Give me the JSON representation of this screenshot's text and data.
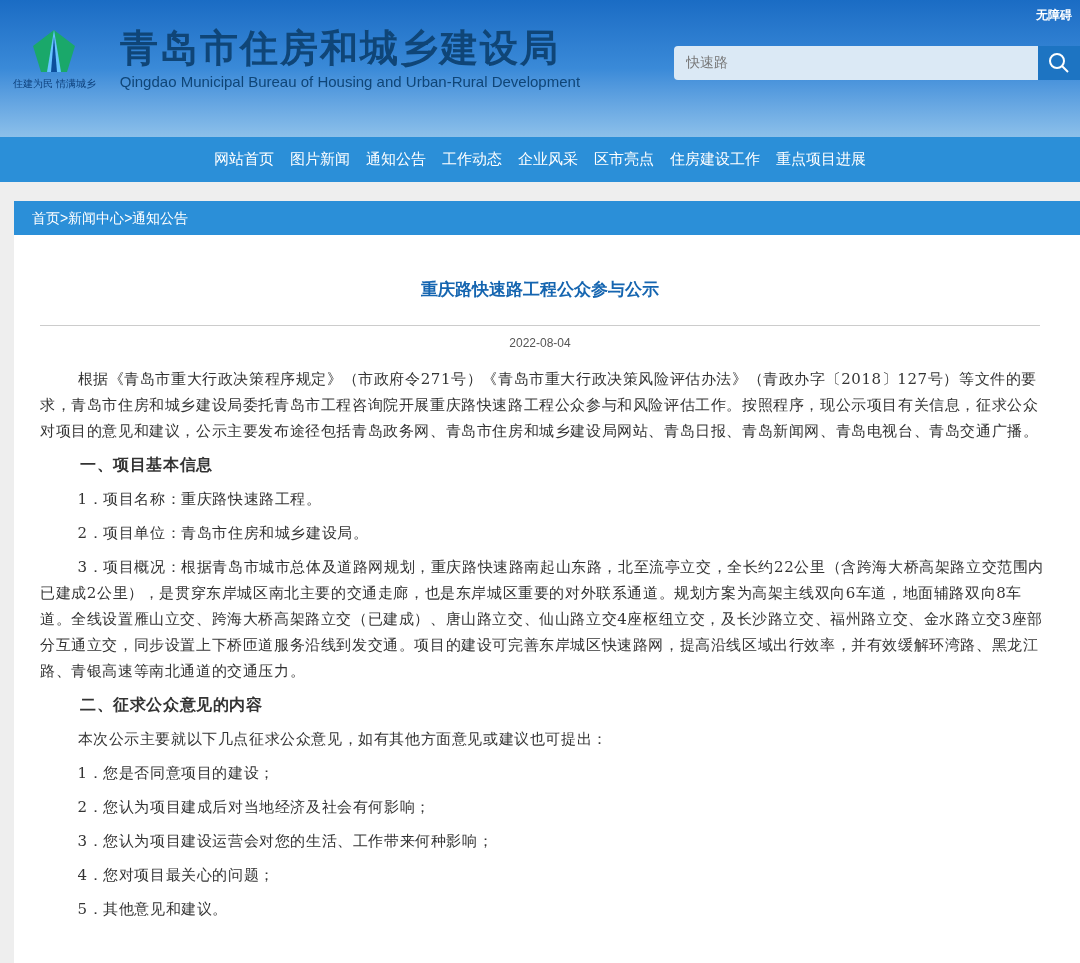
{
  "header": {
    "accessibility_link": "无障碍",
    "site_title": "青岛市住房和城乡建设局",
    "site_subtitle": "Qingdao Municipal Bureau of Housing and Urban-Rural Development",
    "logo_slogan": "住建为民 情满城乡",
    "search": {
      "value": "快速路"
    }
  },
  "nav": [
    "网站首页",
    "图片新闻",
    "通知公告",
    "工作动态",
    "企业风采",
    "区市亮点",
    "住房建设工作",
    "重点项目进展"
  ],
  "breadcrumb": "首页>新闻中心>通知公告",
  "article": {
    "title": "重庆路快速路工程公众参与公示",
    "date": "2022-08-04",
    "paragraphs": [
      {
        "kind": "body",
        "text": "根据《青岛市重大行政决策程序规定》（市政府令271号）《青岛市重大行政决策风险评估办法》（青政办字〔2018〕127号）等文件的要求，青岛市住房和城乡建设局委托青岛市工程咨询院开展重庆路快速路工程公众参与和风险评估工作。按照程序，现公示项目有关信息，征求公众对项目的意见和建议，公示主要发布途径包括青岛政务网、青岛市住房和城乡建设局网站、青岛日报、青岛新闻网、青岛电视台、青岛交通广播。"
      },
      {
        "kind": "heading",
        "text": "一、项目基本信息"
      },
      {
        "kind": "body",
        "text": "1．项目名称：重庆路快速路工程。"
      },
      {
        "kind": "body",
        "text": "2．项目单位：青岛市住房和城乡建设局。"
      },
      {
        "kind": "body",
        "text": "3．项目概况：根据青岛市城市总体及道路网规划，重庆路快速路南起山东路，北至流亭立交，全长约22公里（含跨海大桥高架路立交范围内已建成2公里），是贯穿东岸城区南北主要的交通走廊，也是东岸城区重要的对外联系通道。规划方案为高架主线双向6车道，地面辅路双向8车道。全线设置雁山立交、跨海大桥高架路立交（已建成）、唐山路立交、仙山路立交4座枢纽立交，及长沙路立交、福州路立交、金水路立交3座部分互通立交，同步设置上下桥匝道服务沿线到发交通。项目的建设可完善东岸城区快速路网，提高沿线区域出行效率，并有效缓解环湾路、黑龙江路、青银高速等南北通道的交通压力。"
      },
      {
        "kind": "heading",
        "text": "二、征求公众意见的内容"
      },
      {
        "kind": "body",
        "text": "本次公示主要就以下几点征求公众意见，如有其他方面意见或建议也可提出："
      },
      {
        "kind": "body",
        "text": "1．您是否同意项目的建设；"
      },
      {
        "kind": "body",
        "text": "2．您认为项目建成后对当地经济及社会有何影响；"
      },
      {
        "kind": "body",
        "text": "3．您认为项目建设运营会对您的生活、工作带来何种影响；"
      },
      {
        "kind": "body",
        "text": "4．您对项目最关心的问题；"
      },
      {
        "kind": "body",
        "text": "5．其他意见和建议。"
      }
    ]
  }
}
